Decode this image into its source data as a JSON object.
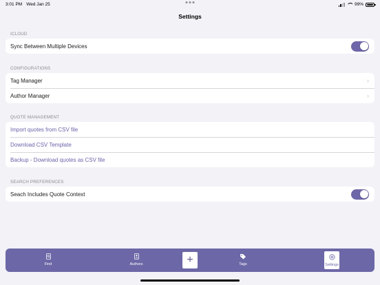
{
  "status_bar": {
    "time": "3:01 PM",
    "date": "Wed Jan 25",
    "battery": "99%",
    "battery_level": 0.99
  },
  "nav": {
    "title": "Settings"
  },
  "sections": {
    "icloud": {
      "header": "ICLOUD",
      "rows": [
        {
          "label": "Sync Between Multiple Devices",
          "toggle_on": true
        }
      ]
    },
    "configurations": {
      "header": "CONFIGURATIONS",
      "rows": [
        {
          "label": "Tag Manager"
        },
        {
          "label": "Author Manager"
        }
      ]
    },
    "quote_management": {
      "header": "QUOTE MANAGEMENT",
      "rows": [
        {
          "label": "Import quotes from CSV file"
        },
        {
          "label": "Download CSV Template"
        },
        {
          "label": "Backup - Download quotes as CSV file"
        }
      ]
    },
    "search_preferences": {
      "header": "SEARCH PREFERENCES",
      "rows": [
        {
          "label": "Seach Includes Quote Context",
          "toggle_on": true
        }
      ]
    }
  },
  "tab_bar": {
    "tabs": [
      {
        "label": "Find",
        "icon": "document-search-icon"
      },
      {
        "label": "Authors",
        "icon": "person-book-icon"
      },
      {
        "label": "Tags",
        "icon": "tag-icon"
      },
      {
        "label": "Settings",
        "icon": "gear-circle-icon"
      }
    ],
    "add_icon": "plus-icon"
  },
  "colors": {
    "accent": "#6c67a6",
    "link": "#6a63a8",
    "background": "#f2f2f7"
  }
}
